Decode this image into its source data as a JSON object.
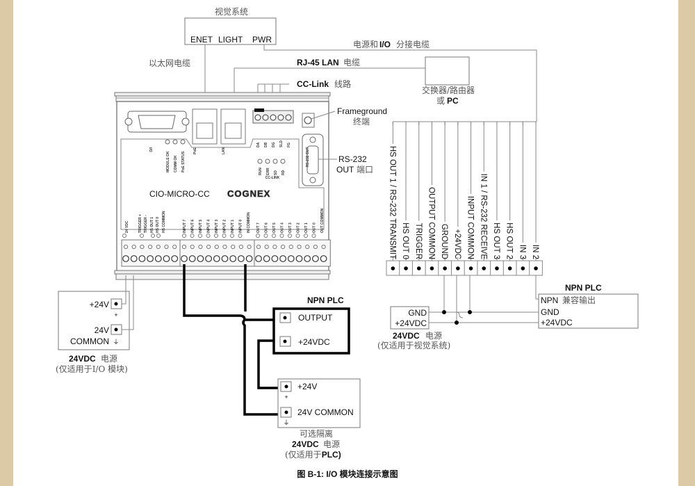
{
  "figure": {
    "caption": "图 B-1: I/O 模块连接示意图"
  },
  "vision_system": {
    "title": "视觉系统",
    "ports": [
      "ENET",
      "LIGHT",
      "PWR"
    ]
  },
  "cables": {
    "ethernet": "以太网电缆",
    "rj45_lan": "RJ-45 LAN",
    "rj45_lan_suffix": "电缆",
    "power_io": "电源和",
    "power_io_io": "I/O",
    "power_io_suffix": "分接电缆",
    "cc_link": "CC-Link",
    "cc_link_suffix": "线路"
  },
  "switch": {
    "line1": "交换器/路由器",
    "line2_cn": "或",
    "line2": "PC"
  },
  "callouts": {
    "frameground": "Frameground",
    "frameground_cn": "终端",
    "rs232": "RS-232",
    "rs232_out": "OUT",
    "rs232_cn": "端口"
  },
  "module": {
    "model": "CIO-MICRO-CC",
    "brand": "COGNEX",
    "io_label": "I/O",
    "status_leds": [
      "MODULE OK",
      "COMM OK",
      "PoE STATUS"
    ],
    "ports": [
      "PoE",
      "LAN"
    ],
    "cc_link_terminals": [
      "DA",
      "DB",
      "DG",
      "SLD",
      "FG"
    ],
    "cc_link_leds": [
      "RUN",
      "ERR",
      "SD",
      "RD"
    ],
    "cc_link_group": "CC-LINK",
    "rs232_label": "RS-232 OUT",
    "terminal_group_1": [
      "24 VDC",
      "TRIGGER +",
      "TRIGGER -",
      "HS OUT 1",
      "HS OUT 0",
      "HS COMMON"
    ],
    "terminal_group_2": [
      "INPUT 7",
      "INPUT 6",
      "INPUT 5",
      "INPUT 4",
      "INPUT 3",
      "INPUT 2",
      "INPUT 1",
      "INPUT 0",
      "IN COMMON"
    ],
    "terminal_group_3": [
      "OUT 7",
      "OUT 6",
      "OUT 5",
      "OUT 4",
      "OUT 3",
      "OUT 2",
      "OUT 1",
      "OUT 0",
      "OUT COMMON"
    ]
  },
  "breakout_terminals": [
    "HS OUT 1 / RS-232 TRANSMIT",
    "HS OUT 0",
    "TRIGGER",
    "OUTPUT COMMON",
    "GROUND",
    "+24VDC",
    "INPUT COMMON",
    "IN 1 / RS-232 RECEIVE",
    "HS OUT 3",
    "HS OUT 2",
    "IN 3",
    "IN 2"
  ],
  "psu_io": {
    "pos": "+24V",
    "common_1": "24V",
    "common_2": "COMMON",
    "plus_sym": "+",
    "gnd_sym": "⏚",
    "title": "24VDC",
    "title_cn": "电源",
    "note_open": "(仅适用于",
    "note_io": "I/O 模块",
    "note_close": ")"
  },
  "npn_plc_center": {
    "title": "NPN PLC",
    "output": "OUTPUT",
    "vdc": "+24VDC"
  },
  "psu_plc": {
    "pos": "+24V",
    "common": "24V COMMON",
    "title_cn": "可选隔离",
    "title": "24VDC",
    "title_cn2": "电源",
    "note_open": "(仅适用于",
    "note_plc": "PLC)"
  },
  "psu_vision": {
    "gnd": "GND",
    "vdc": "+24VDC",
    "title": "24VDC",
    "title_cn": "电源",
    "note": "(仅适用于视觉系统)"
  },
  "npn_plc_right": {
    "title": "NPN PLC",
    "row1": "NPN",
    "row1_cn": "兼容输出",
    "row2": "GND",
    "row3": "+24VDC"
  }
}
